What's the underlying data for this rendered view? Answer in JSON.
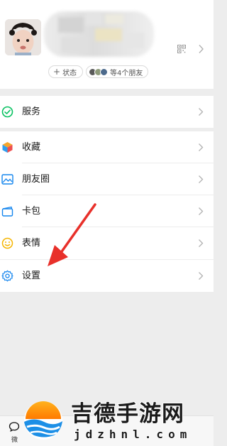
{
  "profile": {
    "status_button": "状态",
    "friends_text": "等4个朋友"
  },
  "menu": {
    "items": [
      {
        "label": "服务",
        "icon": "service-icon"
      },
      {
        "label": "收藏",
        "icon": "favorites-icon"
      },
      {
        "label": "朋友圈",
        "icon": "moments-icon"
      },
      {
        "label": "卡包",
        "icon": "card-wallet-icon"
      },
      {
        "label": "表情",
        "icon": "stickers-icon"
      },
      {
        "label": "设置",
        "icon": "settings-icon"
      }
    ]
  },
  "tabbar": {
    "first_tab_label": "微"
  },
  "watermark": {
    "title": "吉德手游网",
    "domain": "jdzhnl.com"
  },
  "colors": {
    "service_green": "#07c160",
    "moments_blue": "#1485ee",
    "card_blue": "#1485ee",
    "sticker_yellow": "#f5b500",
    "arrow_red": "#e8302a"
  }
}
